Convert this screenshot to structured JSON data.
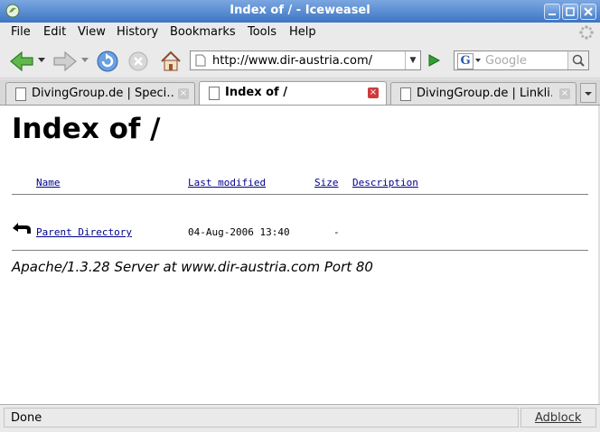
{
  "window": {
    "title": "Index of / - Iceweasel"
  },
  "menu": {
    "items": [
      {
        "label": "File"
      },
      {
        "label": "Edit"
      },
      {
        "label": "View"
      },
      {
        "label": "History"
      },
      {
        "label": "Bookmarks"
      },
      {
        "label": "Tools"
      },
      {
        "label": "Help"
      }
    ]
  },
  "nav": {
    "url": "http://www.dir-austria.com/",
    "search_placeholder": "Google",
    "search_engine_letter": "G"
  },
  "tabs": [
    {
      "label": "DivingGroup.de | Speci…",
      "active": false
    },
    {
      "label": "Index of /",
      "active": true
    },
    {
      "label": "DivingGroup.de | Linkli…",
      "active": false
    }
  ],
  "page": {
    "heading": "Index of /",
    "columns": {
      "name": "Name",
      "modified": "Last modified",
      "size": "Size",
      "description": "Description"
    },
    "rows": [
      {
        "name": "Parent Directory",
        "modified": "04-Aug-2006 13:40",
        "size": "-",
        "description": ""
      }
    ],
    "footer": "Apache/1.3.28 Server at www.dir-austria.com Port 80"
  },
  "status": {
    "text": "Done",
    "addon": "Adblock"
  },
  "colors": {
    "titlebar": "#3d75c4",
    "link": "#00008b",
    "go": "#2fa12f"
  }
}
